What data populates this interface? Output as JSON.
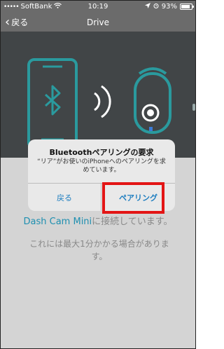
{
  "status_bar": {
    "carrier": "SoftBank",
    "time": "10:19",
    "battery_percent": "93%",
    "icons": [
      "signal-dots-icon",
      "wifi-icon",
      "location-arrow-icon",
      "alarm-icon",
      "battery-icon"
    ]
  },
  "nav": {
    "back_label": "戻る",
    "title": "Drive"
  },
  "main": {
    "device_name": "Dash Cam Mini",
    "connecting_text": "に接続しています。",
    "wait_text": "これには最大1分かかる場合があります。"
  },
  "dialog": {
    "title": "Bluetoothペアリングの要求",
    "message": "“リア”がお使いのiPhoneへのペアリングを求めています。",
    "cancel_label": "戻る",
    "pair_label": "ペアリング"
  },
  "colors": {
    "accent_teal": "#2a9a9e",
    "link_blue": "#1e7ec0",
    "highlight_red": "#e31515",
    "hero_bg": "#414547"
  },
  "illustration_icons": [
    "phone-icon",
    "bluetooth-icon",
    "signal-waves-icon",
    "dash-cam-icon"
  ]
}
